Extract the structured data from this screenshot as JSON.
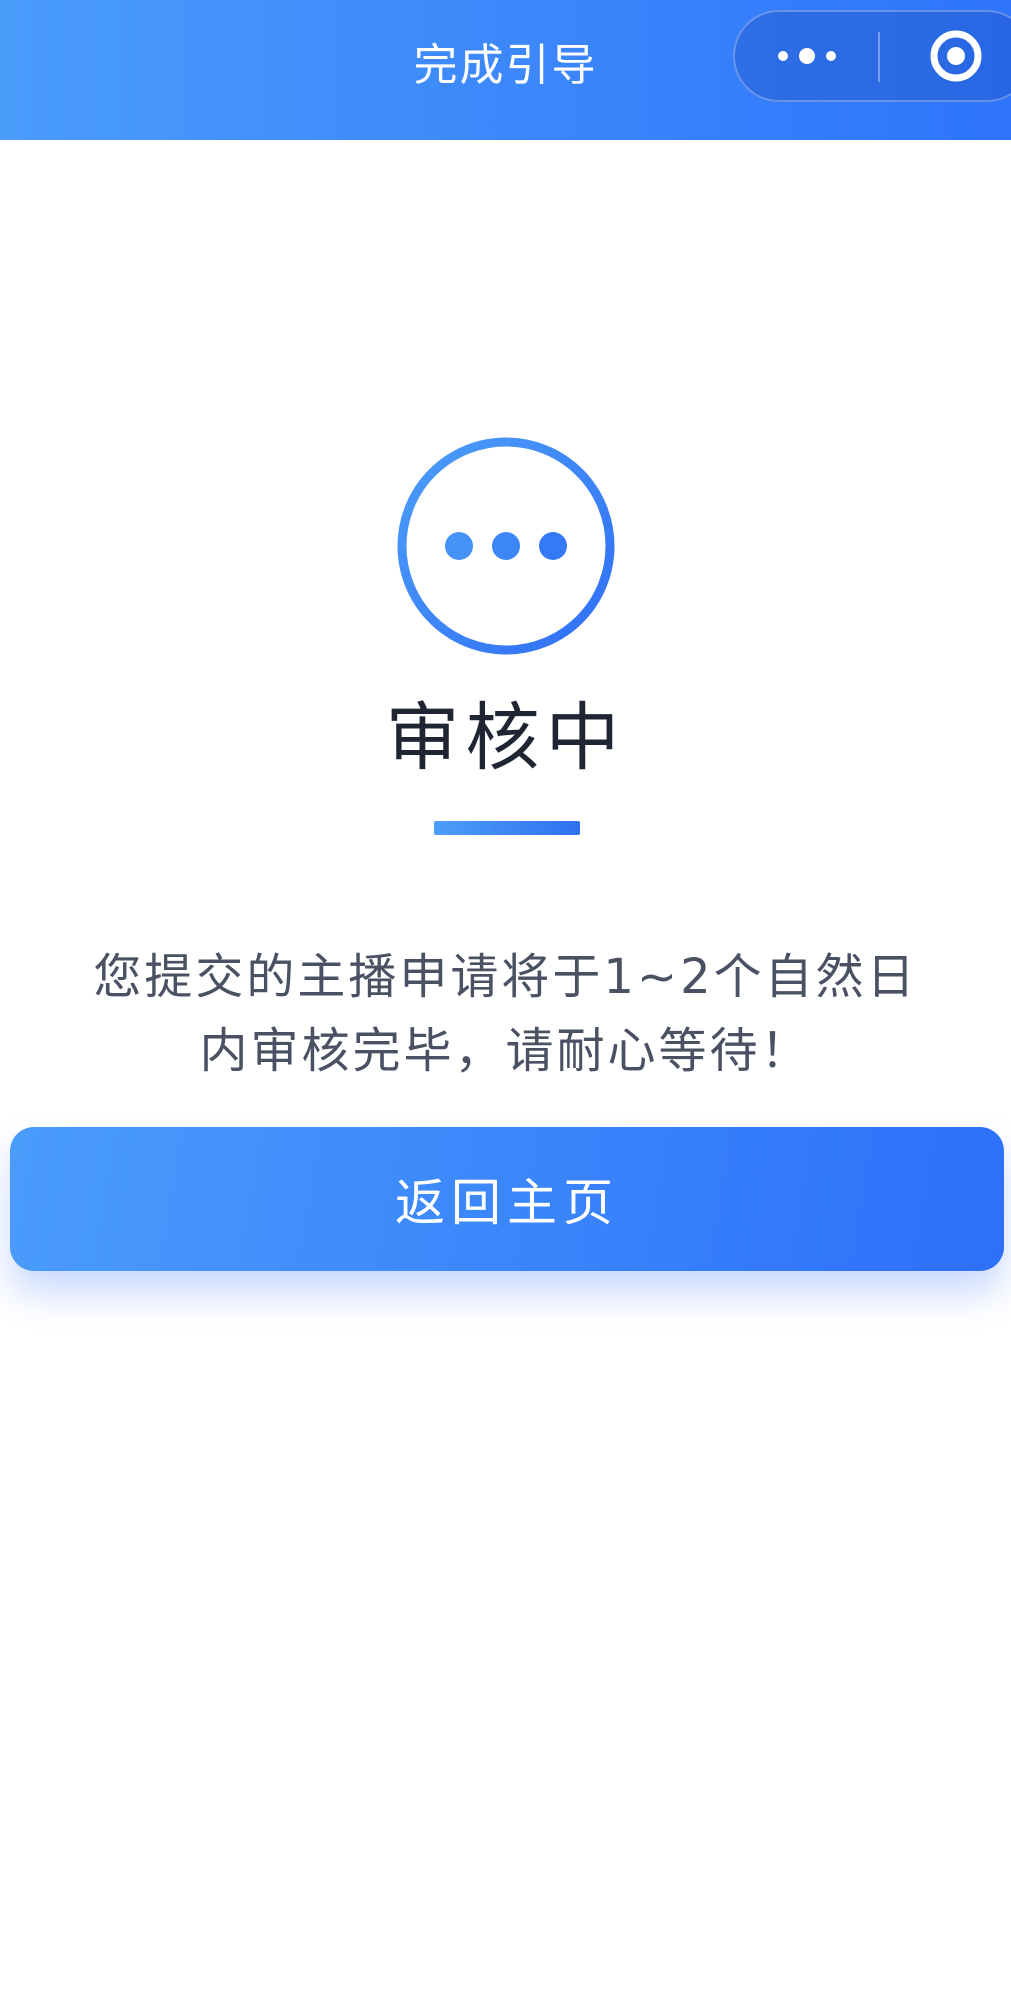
{
  "navbar": {
    "title": "完成引导",
    "more_icon": "more-dots-icon",
    "close_icon": "target-close-icon"
  },
  "status": {
    "icon": "pending-dots-icon",
    "title": "审核中",
    "message": "您提交的主播申请将于1~2个自然日内审核完毕，请耐心等待！"
  },
  "actions": {
    "home_button_label": "返回主页"
  },
  "colors": {
    "primary": "#3b86fb",
    "primary_light": "#4a9cfb",
    "primary_dark": "#2d6ff9",
    "title_text": "#1f2533",
    "body_text": "#4a5163"
  }
}
